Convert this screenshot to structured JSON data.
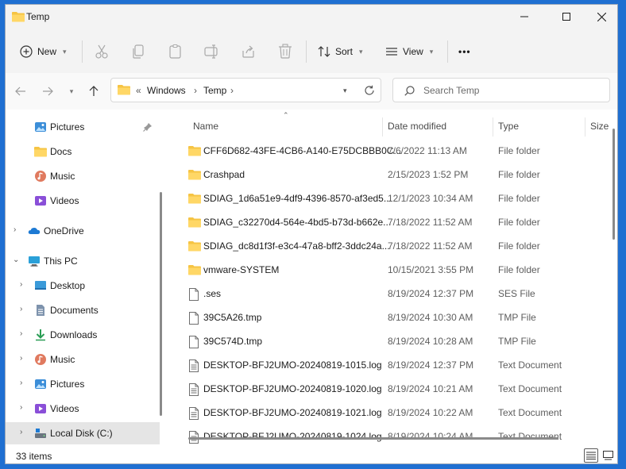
{
  "window": {
    "title": "Temp"
  },
  "toolbar": {
    "new_label": "New",
    "sort_label": "Sort",
    "view_label": "View",
    "more_label": "•••"
  },
  "address": {
    "prefix": "«",
    "crumbs": [
      "Windows",
      "Temp"
    ]
  },
  "search": {
    "placeholder": "Search Temp"
  },
  "nav": {
    "items": [
      {
        "label": "Pictures",
        "icon": "pictures-icon"
      },
      {
        "label": "Docs",
        "icon": "folder-icon"
      },
      {
        "label": "Music",
        "icon": "music-icon"
      },
      {
        "label": "Videos",
        "icon": "videos-icon"
      },
      {
        "label": "OneDrive",
        "icon": "onedrive-icon"
      },
      {
        "label": "This PC",
        "icon": "pc-icon"
      },
      {
        "label": "Desktop",
        "icon": "desktop-icon"
      },
      {
        "label": "Documents",
        "icon": "documents-icon"
      },
      {
        "label": "Downloads",
        "icon": "downloads-icon"
      },
      {
        "label": "Music",
        "icon": "music-icon"
      },
      {
        "label": "Pictures",
        "icon": "pictures-icon"
      },
      {
        "label": "Videos",
        "icon": "videos-icon"
      },
      {
        "label": "Local Disk (C:)",
        "icon": "drive-icon"
      }
    ]
  },
  "columns": {
    "name": "Name",
    "date": "Date modified",
    "type": "Type",
    "size": "Size"
  },
  "files": [
    {
      "name": "CFF6D682-43FE-4CB6-A140-E75DCBBB0C...",
      "date": "7/6/2022 11:13 AM",
      "type": "File folder",
      "kind": "folder"
    },
    {
      "name": "Crashpad",
      "date": "2/15/2023 1:52 PM",
      "type": "File folder",
      "kind": "folder"
    },
    {
      "name": "SDIAG_1d6a51e9-4df9-4396-8570-af3ed5...",
      "date": "12/1/2023 10:34 AM",
      "type": "File folder",
      "kind": "folder"
    },
    {
      "name": "SDIAG_c32270d4-564e-4bd5-b73d-b662e...",
      "date": "7/18/2022 11:52 AM",
      "type": "File folder",
      "kind": "folder"
    },
    {
      "name": "SDIAG_dc8d1f3f-e3c4-47a8-bff2-3ddc24a...",
      "date": "7/18/2022 11:52 AM",
      "type": "File folder",
      "kind": "folder"
    },
    {
      "name": "vmware-SYSTEM",
      "date": "10/15/2021 3:55 PM",
      "type": "File folder",
      "kind": "folder"
    },
    {
      "name": ".ses",
      "date": "8/19/2024 12:37 PM",
      "type": "SES File",
      "kind": "file"
    },
    {
      "name": "39C5A26.tmp",
      "date": "8/19/2024 10:30 AM",
      "type": "TMP File",
      "kind": "file"
    },
    {
      "name": "39C574D.tmp",
      "date": "8/19/2024 10:28 AM",
      "type": "TMP File",
      "kind": "file"
    },
    {
      "name": "DESKTOP-BFJ2UMO-20240819-1015.log",
      "date": "8/19/2024 12:37 PM",
      "type": "Text Document",
      "kind": "text"
    },
    {
      "name": "DESKTOP-BFJ2UMO-20240819-1020.log",
      "date": "8/19/2024 10:21 AM",
      "type": "Text Document",
      "kind": "text"
    },
    {
      "name": "DESKTOP-BFJ2UMO-20240819-1021.log",
      "date": "8/19/2024 10:22 AM",
      "type": "Text Document",
      "kind": "text"
    },
    {
      "name": "DESKTOP-BFJ2UMO-20240819-1024.log",
      "date": "8/19/2024 10:24 AM",
      "type": "Text Document",
      "kind": "text"
    }
  ],
  "status": {
    "count": "33 items"
  },
  "colors": {
    "folder": "#f6c444",
    "accent": "#0067c0",
    "desktop_bg": "#1f6fd1"
  }
}
